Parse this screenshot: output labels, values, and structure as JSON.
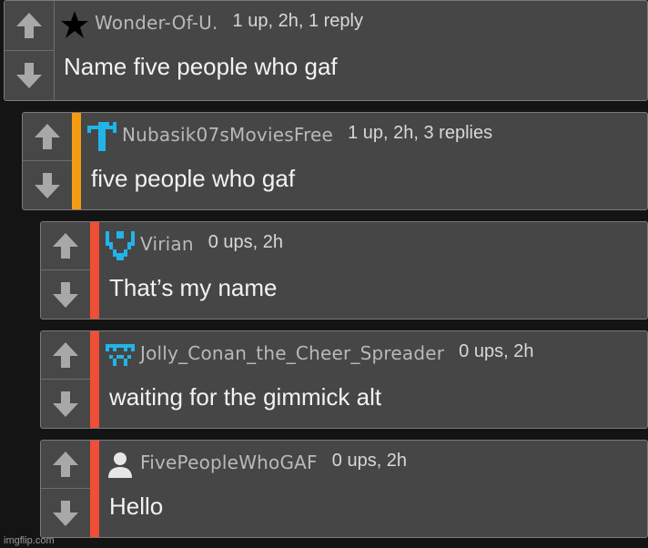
{
  "comments": [
    {
      "username": "Wonder-Of-U.",
      "stats": "1 up, 2h, 1 reply",
      "body": "Name five people who gaf",
      "avatar_icon": "star-icon",
      "accent_color": ""
    },
    {
      "username": "Nubasik07sMoviesFree",
      "stats": "1 up, 2h, 3 replies",
      "body": "five people who gaf",
      "avatar_icon": "pixel-avatar-icon",
      "accent_color": "#f39c12"
    },
    {
      "username": "Virian",
      "stats": "0 ups, 2h",
      "body": "That’s my name",
      "avatar_icon": "pixel-avatar-icon",
      "accent_color": "#f04e36"
    },
    {
      "username": "Jolly_Conan_the_Cheer_Spreader",
      "stats": "0 ups, 2h",
      "body": "waiting for the gimmick alt",
      "avatar_icon": "pixel-avatar-icon",
      "accent_color": "#f04e36"
    },
    {
      "username": "FivePeopleWhoGAF",
      "stats": "0 ups, 2h",
      "body": "Hello",
      "avatar_icon": "default-user-icon",
      "accent_color": "#f04e36"
    }
  ],
  "icons": {
    "upvote": "arrow-up-icon",
    "downvote": "arrow-down-icon"
  },
  "colors": {
    "page_background": "#141414",
    "comment_background": "#464646",
    "pixel_avatar": "#20b5e8",
    "arrow": "#a8a8a8"
  },
  "watermark": "imgflip.com"
}
